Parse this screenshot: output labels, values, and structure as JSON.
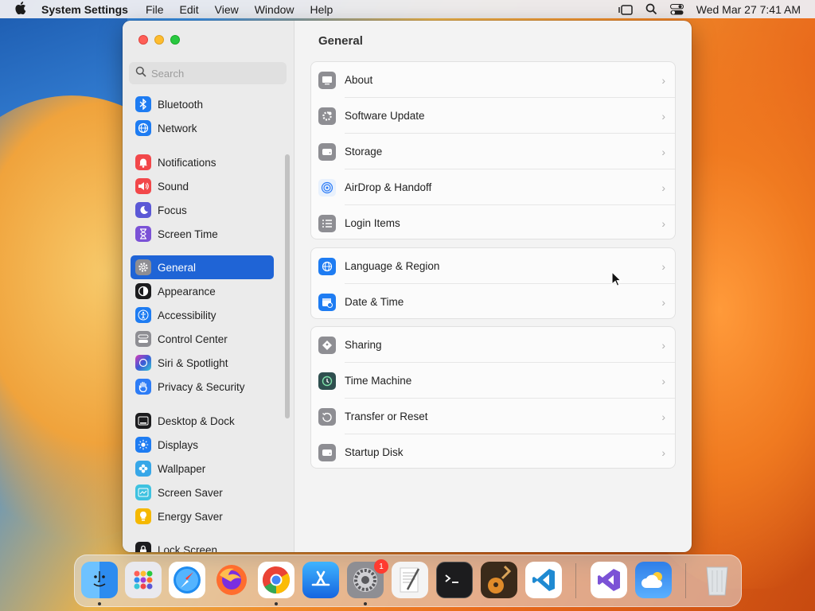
{
  "menubar": {
    "app_name": "System Settings",
    "menus": [
      "File",
      "Edit",
      "View",
      "Window",
      "Help"
    ],
    "clock": "Wed Mar 27  7:41 AM"
  },
  "search": {
    "placeholder": "Search"
  },
  "sidebar": {
    "items": [
      {
        "label": "Bluetooth",
        "icon": "bluetooth-icon",
        "color": "#1e7cf2"
      },
      {
        "label": "Network",
        "icon": "globe-icon",
        "color": "#1e7cf2"
      },
      {
        "label": "Notifications",
        "icon": "bell-icon",
        "color": "#f2474a"
      },
      {
        "label": "Sound",
        "icon": "speaker-icon",
        "color": "#f2474a"
      },
      {
        "label": "Focus",
        "icon": "moon-icon",
        "color": "#5b58d6"
      },
      {
        "label": "Screen Time",
        "icon": "hourglass-icon",
        "color": "#7b52d6"
      },
      {
        "label": "General",
        "icon": "gear-icon",
        "color": "#8e8e93"
      },
      {
        "label": "Appearance",
        "icon": "appearance-icon",
        "color": "#1c1c1e"
      },
      {
        "label": "Accessibility",
        "icon": "accessibility-icon",
        "color": "#1e7cf2"
      },
      {
        "label": "Control Center",
        "icon": "toggles-icon",
        "color": "#8e8e93"
      },
      {
        "label": "Siri & Spotlight",
        "icon": "siri-icon",
        "color": "#a23bd6"
      },
      {
        "label": "Privacy & Security",
        "icon": "hand-icon",
        "color": "#2d7cf6"
      },
      {
        "label": "Desktop & Dock",
        "icon": "dock-icon",
        "color": "#1c1c1e"
      },
      {
        "label": "Displays",
        "icon": "sun-icon",
        "color": "#1e7cf2"
      },
      {
        "label": "Wallpaper",
        "icon": "flower-icon",
        "color": "#37a7e8"
      },
      {
        "label": "Screen Saver",
        "icon": "screensaver-icon",
        "color": "#3ec2e0"
      },
      {
        "label": "Energy Saver",
        "icon": "bulb-icon",
        "color": "#f5b800"
      },
      {
        "label": "Lock Screen",
        "icon": "lock-icon",
        "color": "#1c1c1e"
      }
    ]
  },
  "content": {
    "title": "General",
    "groups": [
      [
        {
          "label": "About",
          "icon": "display-icon",
          "color": "#8e8e93"
        },
        {
          "label": "Software Update",
          "icon": "gear-badge-icon",
          "color": "#8e8e93"
        },
        {
          "label": "Storage",
          "icon": "drive-icon",
          "color": "#8e8e93"
        },
        {
          "label": "AirDrop & Handoff",
          "icon": "airdrop-icon",
          "color": "#e8f1fd"
        },
        {
          "label": "Login Items",
          "icon": "list-icon",
          "color": "#8e8e93"
        }
      ],
      [
        {
          "label": "Language & Region",
          "icon": "globe-icon",
          "color": "#1e7cf2"
        },
        {
          "label": "Date & Time",
          "icon": "calendar-clock-icon",
          "color": "#1e7cf2"
        }
      ],
      [
        {
          "label": "Sharing",
          "icon": "sharing-icon",
          "color": "#8e8e93"
        },
        {
          "label": "Time Machine",
          "icon": "time-machine-icon",
          "color": "#2f4f4f"
        },
        {
          "label": "Transfer or Reset",
          "icon": "reset-icon",
          "color": "#8e8e93"
        },
        {
          "label": "Startup Disk",
          "icon": "disk-icon",
          "color": "#8e8e93"
        }
      ]
    ]
  },
  "dock": {
    "apps": [
      {
        "name": "finder-icon",
        "color": "#2d8cf0",
        "running": true
      },
      {
        "name": "launchpad-icon",
        "color": "#e9e9ee",
        "running": false
      },
      {
        "name": "safari-icon",
        "color": "#1f8cf0",
        "running": false
      },
      {
        "name": "firefox-icon",
        "color": "#ff6d2e",
        "running": false
      },
      {
        "name": "chrome-icon",
        "color": "#ffffff",
        "running": true
      },
      {
        "name": "app-store-icon",
        "color": "#1e90ff",
        "running": false
      },
      {
        "name": "system-settings-icon",
        "color": "#8e8e93",
        "running": true
      },
      {
        "name": "textedit-icon",
        "color": "#f4f4f4",
        "running": false
      },
      {
        "name": "terminal-icon",
        "color": "#1c1c1e",
        "running": false
      },
      {
        "name": "garageband-icon",
        "color": "#3a2a1a",
        "running": false
      },
      {
        "name": "vscode-icon",
        "color": "#ffffff",
        "running": false
      },
      {
        "name": "visual-studio-icon",
        "color": "#ffffff",
        "running": false
      },
      {
        "name": "weather-icon",
        "color": "#2f7ee8",
        "running": false
      },
      {
        "name": "trash-icon",
        "color": "#dfe3e6",
        "running": false
      }
    ],
    "settings_badge": "1"
  }
}
